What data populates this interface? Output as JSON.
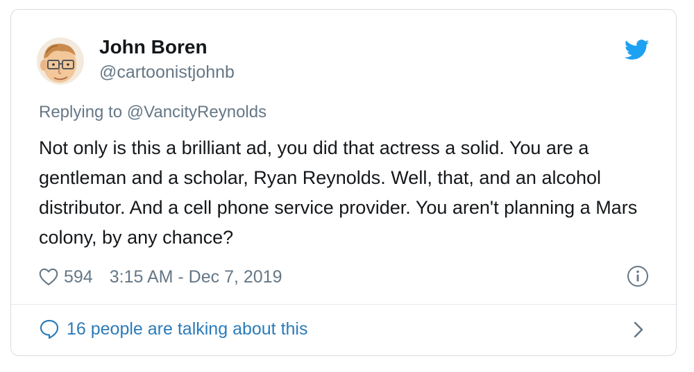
{
  "user": {
    "name": "John Boren",
    "handle": "@cartoonistjohnb",
    "avatar_icon": "cartoon-face-avatar"
  },
  "brand": {
    "icon": "twitter-bird-icon",
    "color": "#1da1f2"
  },
  "reply": {
    "prefix": "Replying to",
    "mention": "@VancityReynolds"
  },
  "tweet": {
    "text": "Not only is this a brilliant ad, you did that actress a solid. You are a gentleman and a scholar, Ryan Reynolds. Well, that, and an alcohol distributor. And a cell phone service provider. You aren't planning a Mars colony, by any chance?"
  },
  "meta": {
    "likes": "594",
    "timestamp": "3:15 AM - Dec 7, 2019",
    "like_icon": "heart-icon",
    "info_icon": "info-icon"
  },
  "footer": {
    "talking_text": "16 people are talking about this",
    "talking_icon": "speech-bubble-icon",
    "chevron_icon": "chevron-right-icon",
    "link_color": "#2b7bb9"
  }
}
